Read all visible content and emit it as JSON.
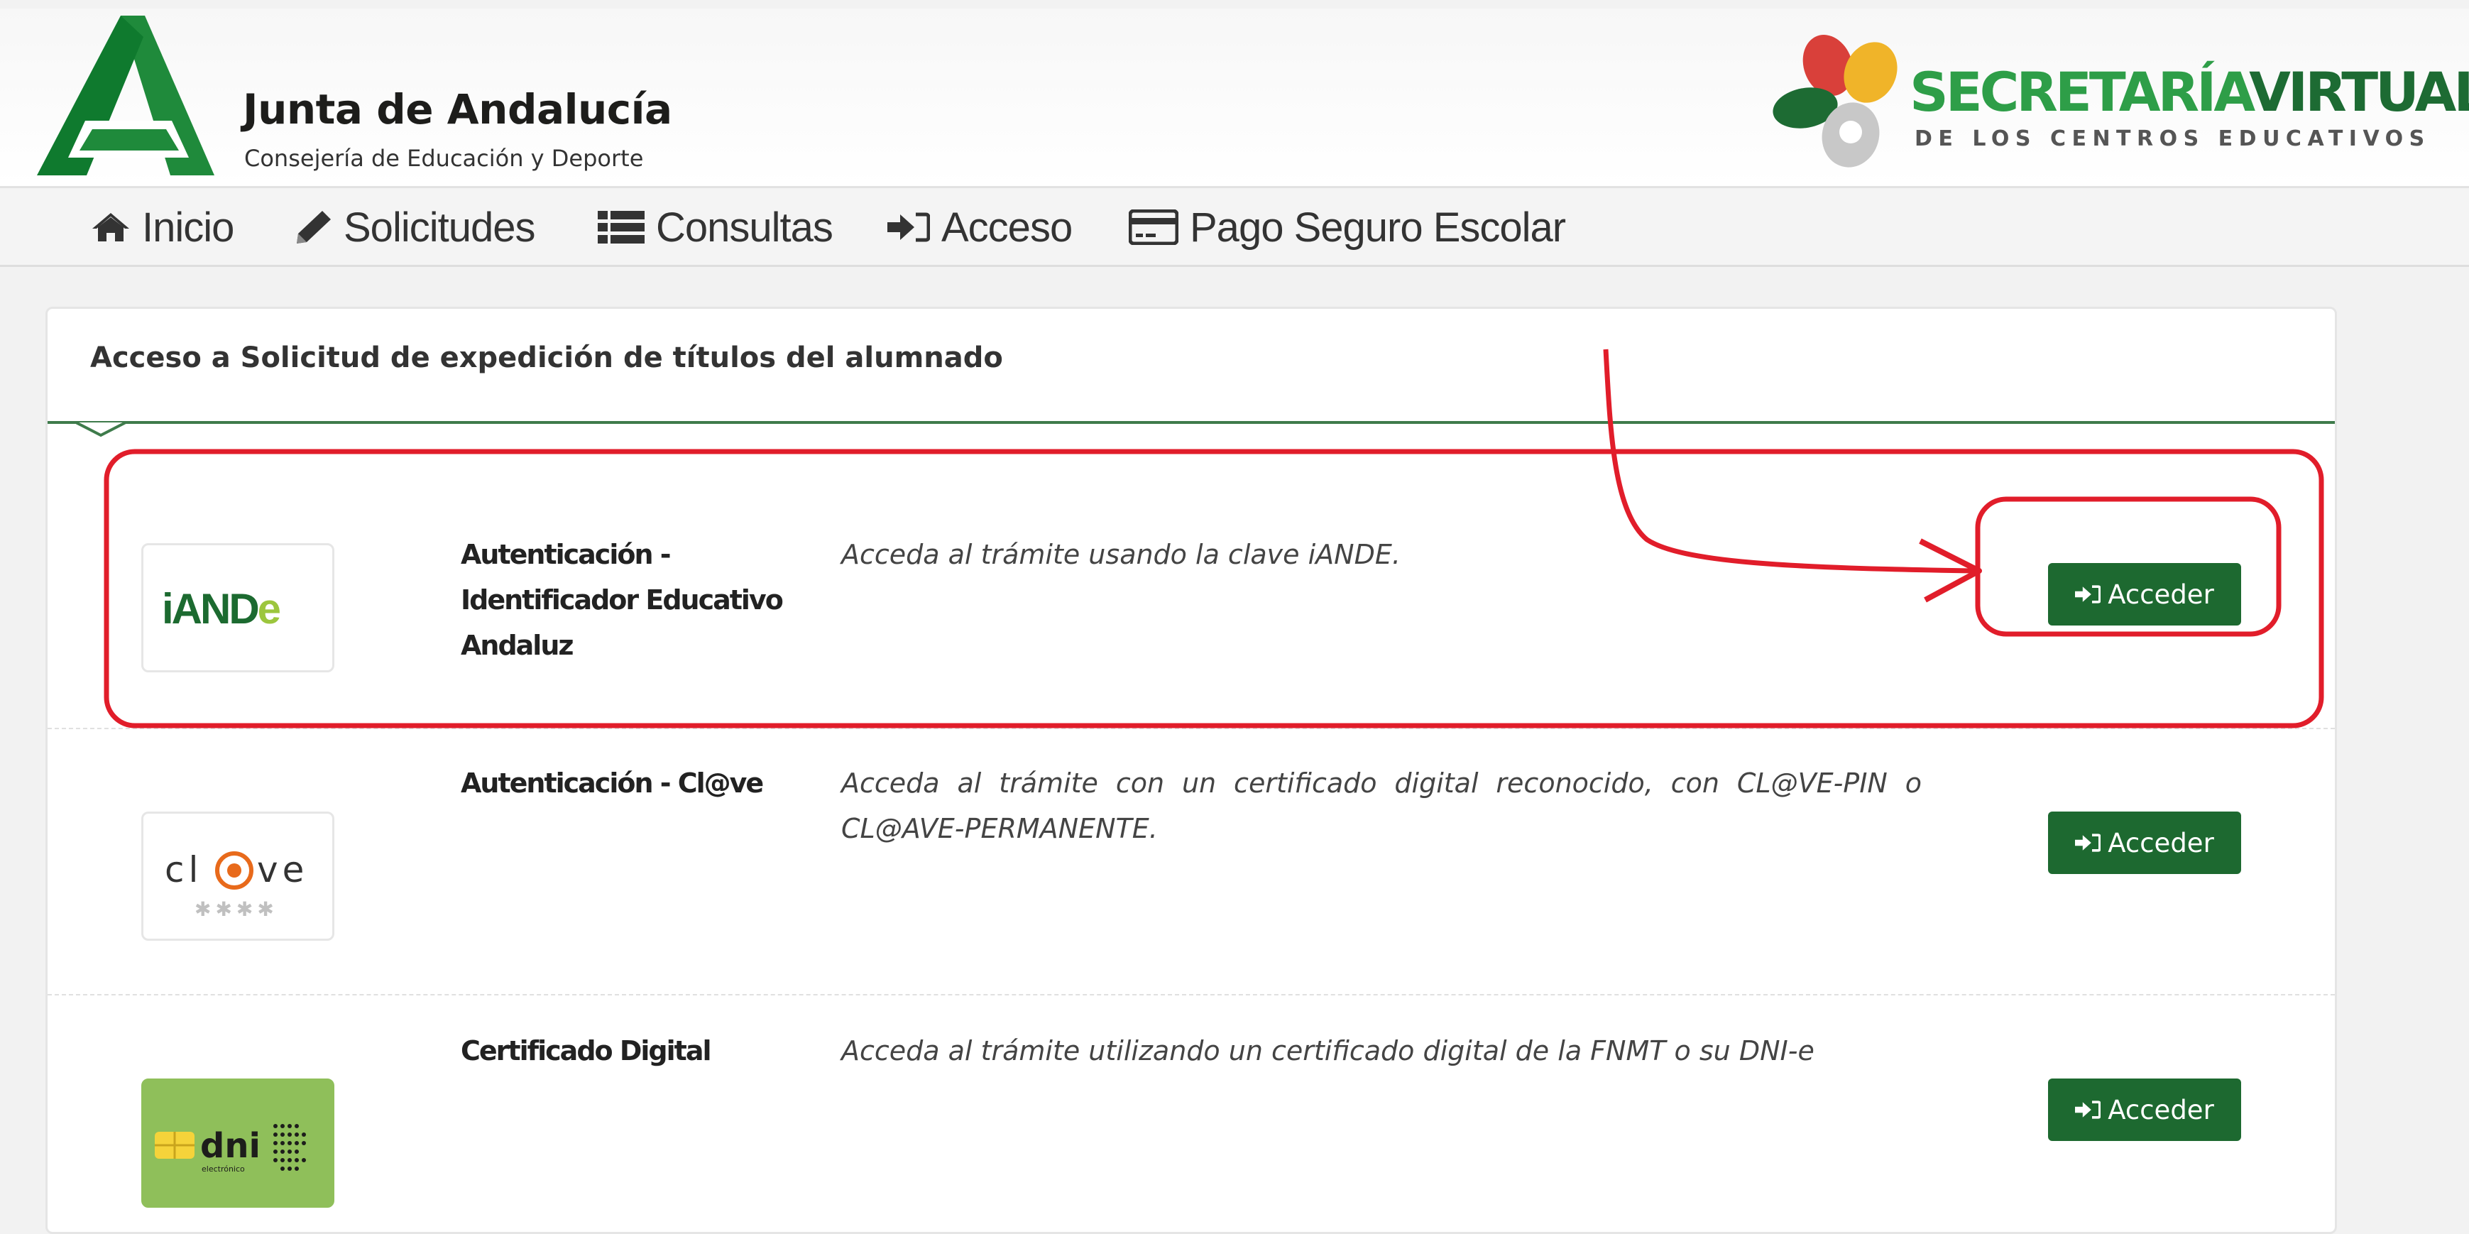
{
  "header": {
    "org_name": "Junta de Andalucía",
    "org_subtitle": "Consejería de Educación y Deporte",
    "brand_part1": "SECRETARÍA",
    "brand_part2": "VIRTUAL",
    "brand_subtitle": "DE LOS CENTROS EDUCATIVOS",
    "colors": {
      "green_dark": "#1d6b33",
      "green": "#2e9e48",
      "red": "#d9403a",
      "yellow": "#f0b429",
      "gray": "#c8c8c8"
    }
  },
  "nav": {
    "items": [
      {
        "label": "Inicio",
        "icon": "home-icon"
      },
      {
        "label": "Solicitudes",
        "icon": "pencil-icon"
      },
      {
        "label": "Consultas",
        "icon": "list-icon"
      },
      {
        "label": "Acceso",
        "icon": "sign-in-icon"
      },
      {
        "label": "Pago Seguro Escolar",
        "icon": "credit-card-icon"
      }
    ]
  },
  "panel": {
    "title": "Acceso a Solicitud de expedición de títulos del alumnado",
    "accent": "#3e7b4b",
    "rows": [
      {
        "logo_text": "iANDe",
        "name": "Autenticación - Identificador Educativo Andaluz",
        "description": "Acceda al trámite usando la clave iANDE.",
        "button_label": "Acceder",
        "highlighted": true
      },
      {
        "logo_text_left": "cl",
        "logo_text_right": "ve",
        "logo_stars": "✱✱✱✱",
        "name": "Autenticación - Cl@ve",
        "description": "Acceda al trámite con un certificado digital reconocido, con CL@VE-PIN o CL@AVE-PERMANENTE.",
        "button_label": "Acceder"
      },
      {
        "logo_text": "dni",
        "logo_subtext": "electrónico",
        "name": "Certificado Digital",
        "description": "Acceda al trámite utilizando un certificado digital de la FNMT o su DNI-e",
        "button_label": "Acceder"
      }
    ],
    "button_color": "#1d6930"
  },
  "annotation": {
    "color": "#e11d2a"
  }
}
